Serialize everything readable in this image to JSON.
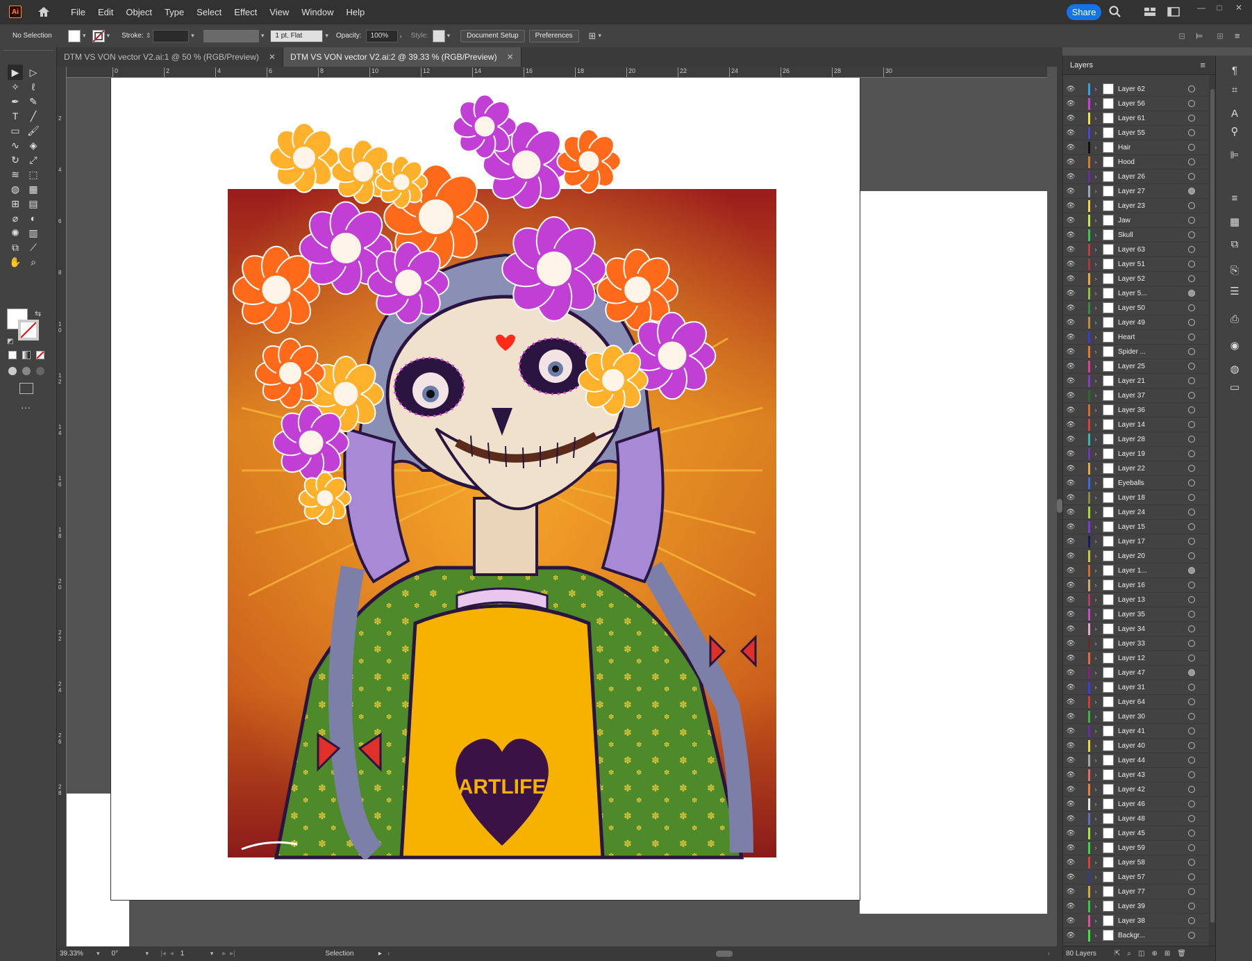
{
  "menubar": {
    "logo": "Ai",
    "menus": [
      "File",
      "Edit",
      "Object",
      "Type",
      "Select",
      "Effect",
      "View",
      "Window",
      "Help"
    ],
    "share_label": "Share",
    "icons": [
      "home-icon",
      "search-icon",
      "arrange-documents-icon",
      "workspace-icon"
    ]
  },
  "control_bar": {
    "selection": "No Selection",
    "stroke_label": "Stroke:",
    "stroke_profile": "1 pt. Flat",
    "opacity_label": "Opacity:",
    "opacity_value": "100%",
    "style_label": "Style:",
    "document_setup": "Document Setup",
    "preferences": "Preferences"
  },
  "tabs": [
    {
      "label": "DTM VS VON vector V2.ai:1 @ 50 % (RGB/Preview)",
      "active": false
    },
    {
      "label": "DTM VS VON vector V2.ai:2 @ 39.33 % (RGB/Preview)",
      "active": true
    }
  ],
  "ruler": {
    "h_ticks": [
      "2",
      "0",
      "2",
      "4",
      "6",
      "8",
      "10",
      "12",
      "14",
      "16",
      "18",
      "20",
      "22",
      "24",
      "26",
      "28",
      "30"
    ],
    "v_ticks": [
      "2",
      "4",
      "6",
      "8",
      "1\n0",
      "1\n2",
      "1\n4",
      "1\n6",
      "1\n8",
      "2\n0",
      "2\n2",
      "2\n4",
      "2\n6",
      "2\n8"
    ]
  },
  "artwork": {
    "lettering": "ARTLIFE",
    "colors": {
      "bg_top": "#9b1c1c",
      "bg_mid": "#d77a1e",
      "flower_orange": "#ff6a1a",
      "flower_yellow": "#ffb12b",
      "flower_purple": "#c23fd6",
      "robe_green": "#4f8a2a",
      "robe_yellow": "#f7b200",
      "heart": "#3b1246"
    }
  },
  "status_bar": {
    "zoom": "39.33%",
    "rotation": "0°",
    "artboard": "1",
    "tool": "Selection"
  },
  "layers_panel": {
    "title": "Layers",
    "count_label": "80 Layers",
    "layers": [
      {
        "name": "Layer 62",
        "color": "#3a9ee8",
        "target": false
      },
      {
        "name": "Layer 56",
        "color": "#d13adf",
        "target": false
      },
      {
        "name": "Layer 61",
        "color": "#f2e640",
        "target": false
      },
      {
        "name": "Layer 55",
        "color": "#4646d8",
        "target": false
      },
      {
        "name": "Hair",
        "color": "#111111",
        "target": false
      },
      {
        "name": "Hood",
        "color": "#d87a2a",
        "target": false
      },
      {
        "name": "Layer 26",
        "color": "#6a2aa8",
        "target": false
      },
      {
        "name": "Layer 27",
        "color": "#9aa8b8",
        "target": true
      },
      {
        "name": "Layer 23",
        "color": "#f2d24a",
        "target": false
      },
      {
        "name": "Jaw",
        "color": "#c8e84a",
        "target": false
      },
      {
        "name": "Skull",
        "color": "#3ac84a",
        "target": false
      },
      {
        "name": "Layer 63",
        "color": "#c83a3a",
        "target": false
      },
      {
        "name": "Layer 51",
        "color": "#a83a3a",
        "target": false
      },
      {
        "name": "Layer 52",
        "color": "#f0a83a",
        "target": false
      },
      {
        "name": "Layer 5...",
        "color": "#8ac83a",
        "target": true
      },
      {
        "name": "Layer 50",
        "color": "#3a8a3a",
        "target": false
      },
      {
        "name": "Layer 49",
        "color": "#c88a3a",
        "target": false
      },
      {
        "name": "Heart",
        "color": "#3a3ad8",
        "target": false
      },
      {
        "name": "Spider ...",
        "color": "#e87a2a",
        "target": false
      },
      {
        "name": "Layer 25",
        "color": "#e83a9a",
        "target": false
      },
      {
        "name": "Layer 21",
        "color": "#8a3ac8",
        "target": false
      },
      {
        "name": "Layer 37",
        "color": "#2a6a2a",
        "target": false
      },
      {
        "name": "Layer 36",
        "color": "#d86a2a",
        "target": false
      },
      {
        "name": "Layer 14",
        "color": "#e83a3a",
        "target": false
      },
      {
        "name": "Layer 28",
        "color": "#3ab8a8",
        "target": false
      },
      {
        "name": "Layer 19",
        "color": "#6a3ab8",
        "target": false
      },
      {
        "name": "Layer 22",
        "color": "#e8a83a",
        "target": false
      },
      {
        "name": "Eyeballs",
        "color": "#3a6ae8",
        "target": false
      },
      {
        "name": "Layer 18",
        "color": "#8a8a3a",
        "target": false
      },
      {
        "name": "Layer 24",
        "color": "#a8d83a",
        "target": false
      },
      {
        "name": "Layer 15",
        "color": "#7a3ad8",
        "target": false
      },
      {
        "name": "Layer 17",
        "color": "#1a1a6a",
        "target": false
      },
      {
        "name": "Layer 20",
        "color": "#c8c83a",
        "target": false
      },
      {
        "name": "Layer 1...",
        "color": "#d86a2a",
        "target": true
      },
      {
        "name": "Layer 16",
        "color": "#d8a86a",
        "target": false
      },
      {
        "name": "Layer 13",
        "color": "#b83a6a",
        "target": false
      },
      {
        "name": "Layer 35",
        "color": "#c84ac8",
        "target": false
      },
      {
        "name": "Layer 34",
        "color": "#e8a8c8",
        "target": false
      },
      {
        "name": "Layer 33",
        "color": "#6a2a2a",
        "target": false
      },
      {
        "name": "Layer 12",
        "color": "#e86a3a",
        "target": false
      },
      {
        "name": "Layer 47",
        "color": "#8a1a8a",
        "target": true
      },
      {
        "name": "Layer 31",
        "color": "#3a3ae8",
        "target": false
      },
      {
        "name": "Layer 64",
        "color": "#d83a3a",
        "target": false
      },
      {
        "name": "Layer 30",
        "color": "#3ab83a",
        "target": false
      },
      {
        "name": "Layer 41",
        "color": "#6a2aa8",
        "target": false
      },
      {
        "name": "Layer 40",
        "color": "#e8d83a",
        "target": false
      },
      {
        "name": "Layer 44",
        "color": "#a8a8a8",
        "target": false
      },
      {
        "name": "Layer 43",
        "color": "#e86a6a",
        "target": false
      },
      {
        "name": "Layer 42",
        "color": "#e87a3a",
        "target": false
      },
      {
        "name": "Layer 46",
        "color": "#e8e8e8",
        "target": false
      },
      {
        "name": "Layer 48",
        "color": "#6a6ab8",
        "target": false
      },
      {
        "name": "Layer 45",
        "color": "#a8e83a",
        "target": false
      },
      {
        "name": "Layer 59",
        "color": "#3ad83a",
        "target": false
      },
      {
        "name": "Layer 58",
        "color": "#e83a3a",
        "target": false
      },
      {
        "name": "Layer 57",
        "color": "#3a3a8a",
        "target": false
      },
      {
        "name": "Layer 77",
        "color": "#d8a83a",
        "target": false
      },
      {
        "name": "Layer 39",
        "color": "#3ac83a",
        "target": false
      },
      {
        "name": "Layer 38",
        "color": "#e84a9a",
        "target": false
      },
      {
        "name": "Backgr...",
        "color": "#3ae83a",
        "target": false
      }
    ]
  },
  "right_icons": [
    "paragraph-icon",
    "transform-icon",
    "character-icon",
    "puppet-warp-icon",
    "align-icon",
    "stroke-icon",
    "swatches-icon",
    "pathfinder-icon",
    "links-icon",
    "properties-icon",
    "asset-export-icon",
    "appearance-icon",
    "color-icon",
    "gradient-icon"
  ]
}
